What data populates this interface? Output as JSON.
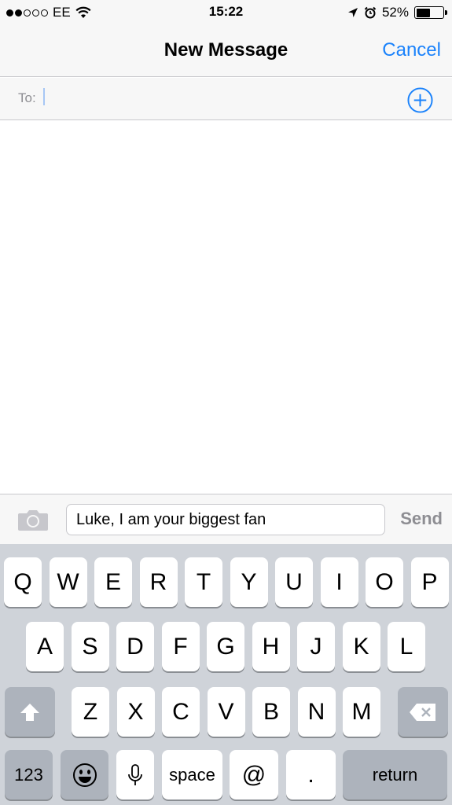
{
  "status_bar": {
    "carrier": "EE",
    "time": "15:22",
    "battery_percent": "52%",
    "battery_level": 0.52,
    "icons": [
      "signal-dots",
      "wifi-icon",
      "location-icon",
      "alarm-icon",
      "battery-icon"
    ]
  },
  "nav": {
    "title": "New Message",
    "cancel_label": "Cancel"
  },
  "to_field": {
    "label": "To:",
    "value": ""
  },
  "compose": {
    "message_text": "Luke, I am your biggest fan",
    "send_label": "Send"
  },
  "keyboard": {
    "row1": [
      "Q",
      "W",
      "E",
      "R",
      "T",
      "Y",
      "U",
      "I",
      "O",
      "P"
    ],
    "row2": [
      "A",
      "S",
      "D",
      "F",
      "G",
      "H",
      "J",
      "K",
      "L"
    ],
    "row3": [
      "Z",
      "X",
      "C",
      "V",
      "B",
      "N",
      "M"
    ],
    "numbers_label": "123",
    "space_label": "space",
    "at_label": "@",
    "period_label": ".",
    "return_label": "return"
  },
  "colors": {
    "accent": "#1a82fb",
    "keyboard_bg": "#cfd3d9",
    "dark_key": "#adb3bc"
  }
}
